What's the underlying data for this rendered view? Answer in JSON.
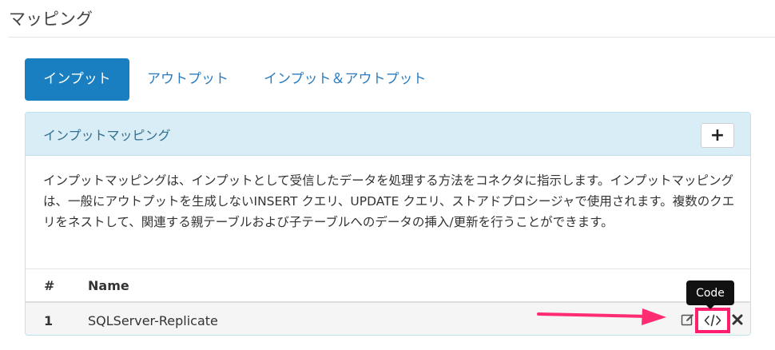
{
  "page": {
    "title": "マッピング"
  },
  "tabs": [
    {
      "label": "インプット",
      "active": true
    },
    {
      "label": "アウトプット",
      "active": false
    },
    {
      "label": "インプット＆アウトプット",
      "active": false
    }
  ],
  "panel": {
    "title": "インプットマッピング",
    "add_label": "+",
    "description": "インプットマッピングは、インプットとして受信したデータを処理する方法をコネクタに指示します。インプットマッピングは、一般にアウトプットを生成しないINSERT クエリ、UPDATE クエリ、ストアドプロシージャで使用されます。複数のクエリをネストして、関連する親テーブルおよび子テーブルへのデータの挿入/更新を行うことができます。"
  },
  "table": {
    "columns": [
      "#",
      "Name"
    ],
    "rows": [
      {
        "num": "1",
        "name": "SQLServer-Replicate"
      }
    ]
  },
  "tooltip": {
    "text": "Code"
  },
  "colors": {
    "accent": "#1a7fc1",
    "highlight": "#ff1f6e",
    "panel_header": "#d9edf7"
  },
  "icons": [
    "edit-icon",
    "code-icon",
    "delete-icon",
    "annotation-arrow"
  ]
}
